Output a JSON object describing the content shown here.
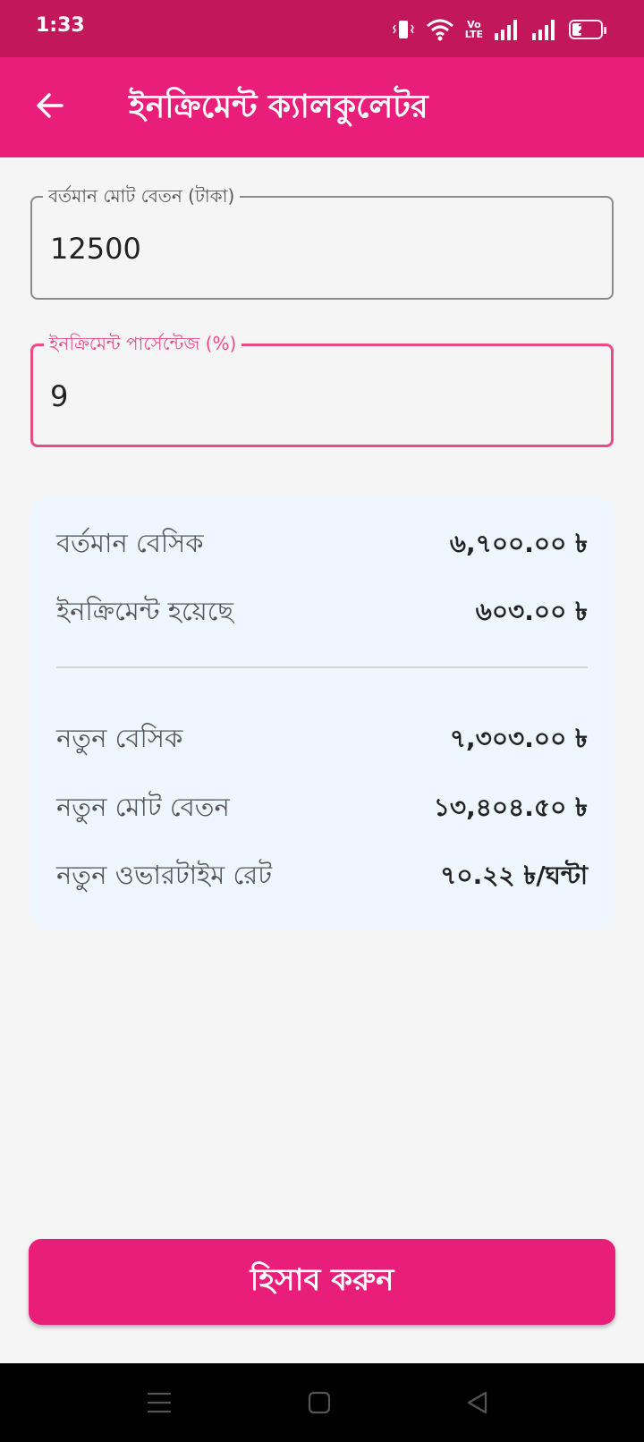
{
  "status_bar": {
    "time": "1:33",
    "volte_top": "Vo",
    "volte_bottom": "LTE",
    "battery_level": "22",
    "icons": [
      "vibrate-icon",
      "wifi-icon",
      "volte-icon",
      "signal-icon",
      "signal-icon",
      "battery-icon"
    ]
  },
  "app_bar": {
    "title": "ইনক্রিমেন্ট ক্যালকুলেটর",
    "back_icon": "arrow-back-icon"
  },
  "form": {
    "salary": {
      "label": "বর্তমান মোট বেতন (টাকা)",
      "value": "12500"
    },
    "increment": {
      "label": "ইনক্রিমেন্ট পার্সেন্টেজ (%)",
      "value": "9"
    }
  },
  "results": {
    "current_basic": {
      "label": "বর্তমান বেসিক",
      "value": "৬,৭০০.০০ ৳"
    },
    "increment_amount": {
      "label": "ইনক্রিমেন্ট হয়েছে",
      "value": "৬০৩.০০ ৳"
    },
    "new_basic": {
      "label": "নতুন বেসিক",
      "value": "৭,৩০৩.০০ ৳"
    },
    "new_total": {
      "label": "নতুন মোট বেতন",
      "value": "১৩,৪০৪.৫০ ৳"
    },
    "overtime_rate": {
      "label": "নতুন ওভারটাইম রেট",
      "value": "৭০.২২ ৳/ঘন্টা"
    }
  },
  "actions": {
    "calculate_label": "হিসাব করুন"
  },
  "colors": {
    "status_bar": "#c2185b",
    "primary": "#e91e7a",
    "focused_outline": "#e94b87",
    "card_bg": "#eef6ff",
    "page_bg": "#f5f5f5"
  }
}
